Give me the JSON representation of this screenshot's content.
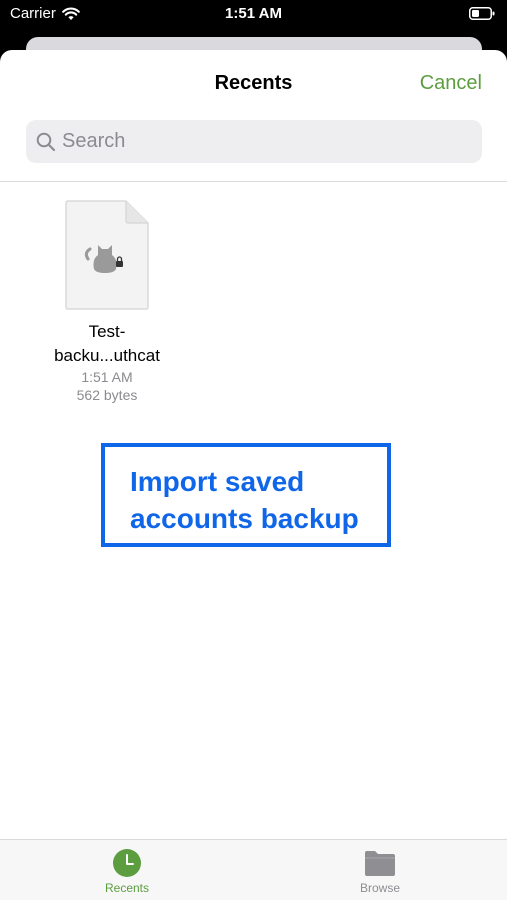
{
  "status_bar": {
    "carrier": "Carrier",
    "time": "1:51 AM"
  },
  "header": {
    "title": "Recents",
    "cancel_label": "Cancel"
  },
  "search": {
    "placeholder": "Search"
  },
  "files": [
    {
      "name_line1": "Test-",
      "name_line2": "backu...uthcat",
      "time": "1:51 AM",
      "size": "562 bytes",
      "icon": "cat-lock-icon"
    }
  ],
  "callout": {
    "line1": "Import saved",
    "line2": "accounts backup"
  },
  "tabs": [
    {
      "label": "Recents",
      "icon": "clock-icon",
      "active": true
    },
    {
      "label": "Browse",
      "icon": "folder-icon",
      "active": false
    }
  ],
  "colors": {
    "accent": "#5c9e3f",
    "callout": "#1066e8",
    "inactive_tab": "#8e8e93"
  }
}
